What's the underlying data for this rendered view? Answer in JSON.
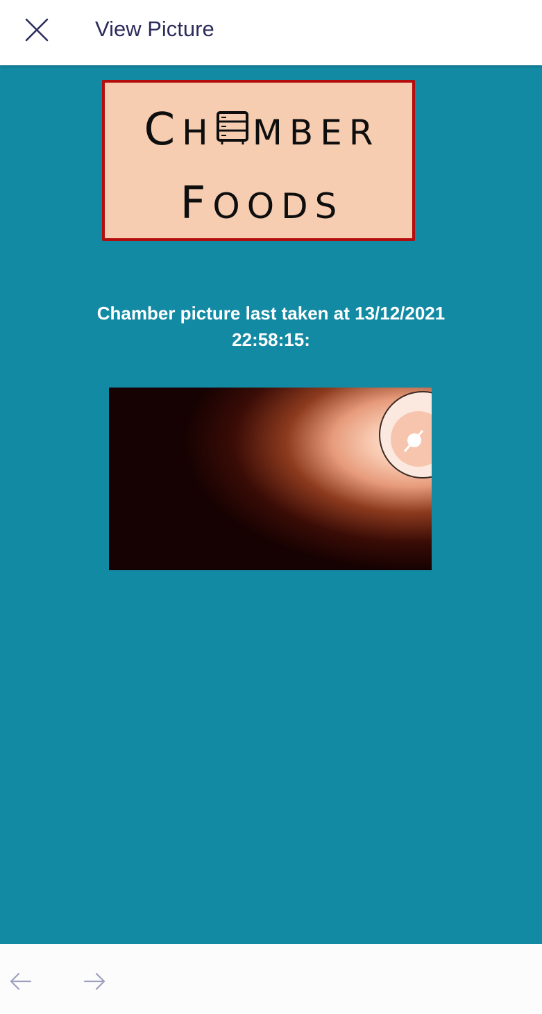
{
  "header": {
    "title": "View Picture",
    "close_icon": "close-icon"
  },
  "logo": {
    "line1": "CHAMBER",
    "line2": "FOODS",
    "border_color": "#b30d0d",
    "background_color": "#f7cdb1"
  },
  "caption": {
    "line1": "Chamber picture last taken at 13/12/2021",
    "line2": "22:58:15:"
  },
  "photo": {
    "description_icon": "chamber-photo"
  },
  "footer": {
    "back_icon": "arrow-left-icon",
    "forward_icon": "arrow-right-icon"
  },
  "colors": {
    "accent": "#138aa4",
    "title_text": "#2b2c5c",
    "nav_icon": "#9fa0bd"
  }
}
